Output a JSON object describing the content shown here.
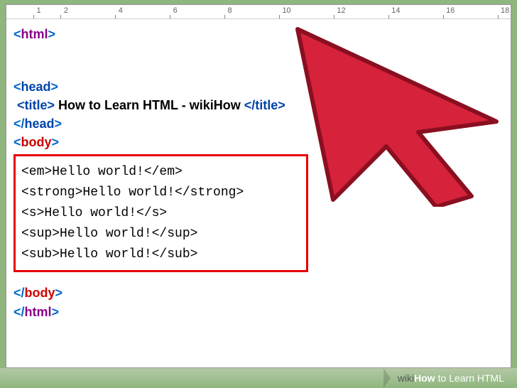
{
  "ruler": {
    "marks": [
      1,
      2,
      4,
      6,
      8,
      10,
      12,
      14,
      16,
      18
    ]
  },
  "code": {
    "html_open": {
      "open": "<",
      "name": "html",
      "close": ">"
    },
    "head_open": {
      "open": "<",
      "name": "head",
      "close": ">"
    },
    "title_line": {
      "tag_open": "<title>",
      "text": " How to Learn HTML - wikiHow ",
      "tag_close": "</title>"
    },
    "head_close": {
      "open": "</",
      "name": "head",
      "close": ">"
    },
    "body_open": {
      "open": "<",
      "name": "body",
      "close": ">"
    },
    "highlighted_lines": [
      "<em>Hello world!</em>",
      "<strong>Hello world!</strong>",
      "<s>Hello world!</s>",
      "<sup>Hello world!</sup>",
      "<sub>Hello world!</sub>"
    ],
    "body_close": {
      "open": "</",
      "name": "body",
      "close": ">"
    },
    "html_close": {
      "open": "</",
      "name": "html",
      "close": ">"
    }
  },
  "footer": {
    "brand_wiki": "wiki",
    "brand_how": "How",
    "title": " to Learn HTML"
  },
  "arrow": {
    "fill": "#d6223a",
    "stroke": "#8a0f20"
  }
}
